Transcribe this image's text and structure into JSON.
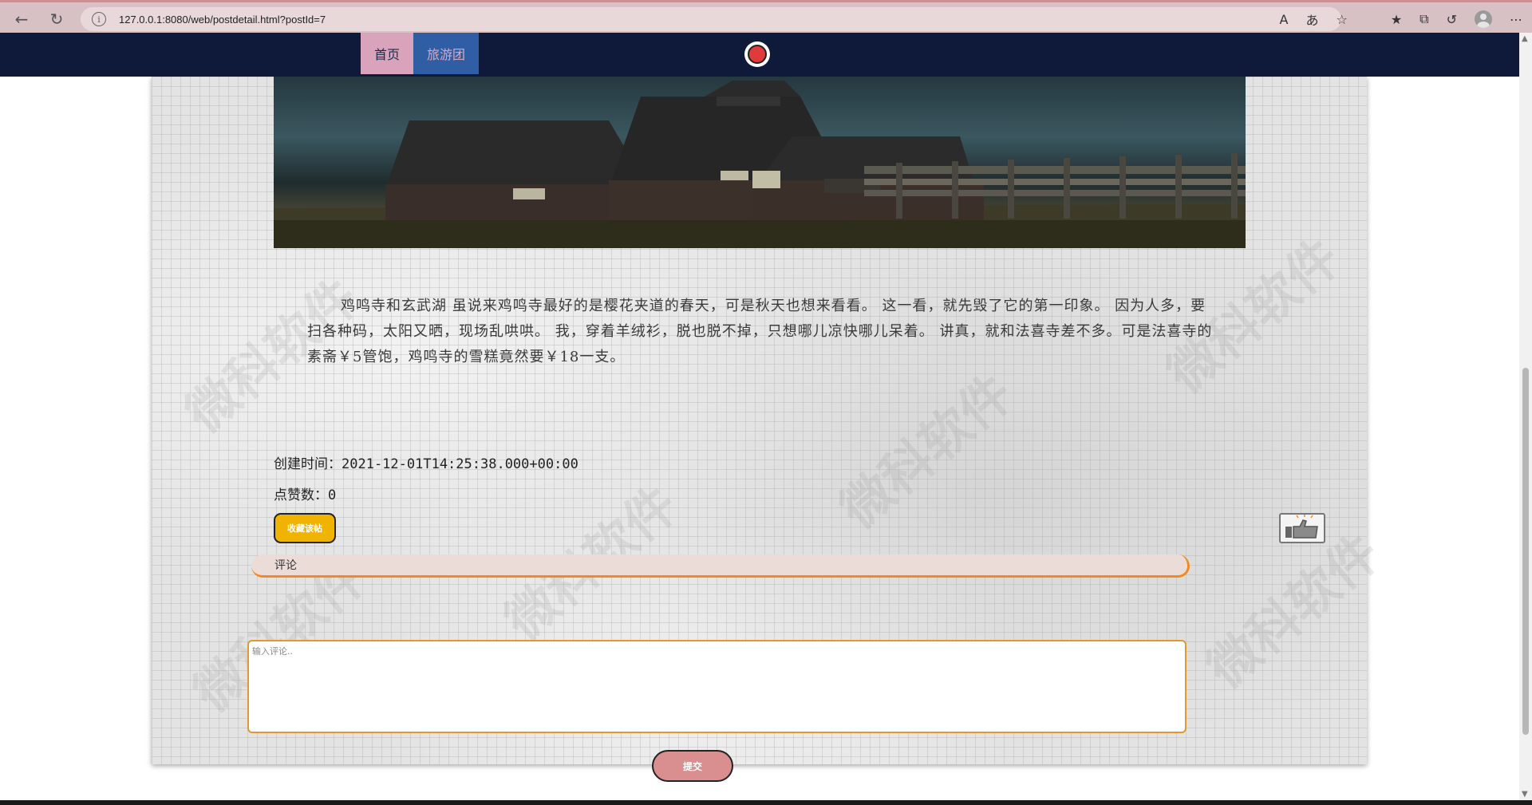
{
  "browser": {
    "url": "127.0.0.1:8080/web/postdetail.html?postId=7",
    "info_symbol": "i",
    "read_aloud_symbol": "A",
    "translate_symbol": "あ"
  },
  "nav": {
    "home_label": "首页",
    "tour_label": "旅游团"
  },
  "post": {
    "content": "鸡鸣寺和玄武湖 虽说来鸡鸣寺最好的是樱花夹道的春天，可是秋天也想来看看。 这一看，就先毁了它的第一印象。 因为人多，要扫各种码，太阳又晒，现场乱哄哄。 我，穿着羊绒衫，脱也脱不掉，只想哪儿凉快哪儿呆着。 讲真，就和法喜寺差不多。可是法喜寺的素斋￥5管饱，鸡鸣寺的雪糕竟然要￥18一支。",
    "created_label": "创建时间：2021-12-01T14:25:38.000+00:00",
    "likes_label": "点赞数：0",
    "favorite_button": "收藏该帖"
  },
  "comments": {
    "header": "评论",
    "input_placeholder": "输入评论..",
    "submit_button": "提交"
  },
  "watermark_text": "微科软件",
  "colors": {
    "nav_bg": "#0f1a3a",
    "home_tab": "#d8a3bb",
    "tour_tab": "#2f5ea4",
    "favorite_button": "#f0b400",
    "submit_button": "#d98f8f",
    "accent_orange": "#f08a24"
  },
  "icons": {
    "back": "back-arrow-icon",
    "refresh": "refresh-icon",
    "favorites": "favorites-icon",
    "collections": "collections-icon",
    "history": "history-icon",
    "profile": "profile-avatar-icon",
    "more": "more-icon",
    "like": "thumbs-up-icon"
  }
}
